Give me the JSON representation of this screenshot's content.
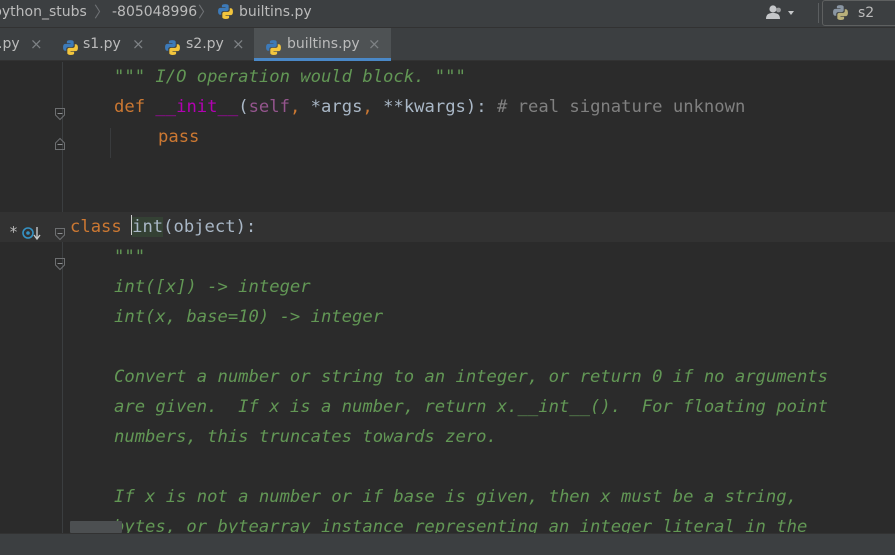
{
  "breadcrumb": {
    "items": [
      "python_stubs",
      "-805048996",
      "builtins.py"
    ]
  },
  "run_config": {
    "label": "s2"
  },
  "tabs": [
    {
      "label": ".py",
      "active": false
    },
    {
      "label": "s1.py",
      "active": false
    },
    {
      "label": "s2.py",
      "active": false
    },
    {
      "label": "builtins.py",
      "active": true
    }
  ],
  "icons": {
    "close": "×",
    "chevron": "〉",
    "star_marker": "*"
  },
  "colors": {
    "keyword": "#cc7832",
    "docstring": "#629755",
    "comment": "#808080",
    "accent": "#4a88c7"
  },
  "code_lines": [
    [
      {
        "c": "doc",
        "t": "\"\"\" I/O operation would block. \"\"\""
      }
    ],
    [
      {
        "c": "kw",
        "t": "def "
      },
      {
        "c": "fn",
        "t": "__init__"
      },
      {
        "c": "dflt",
        "t": "("
      },
      {
        "c": "slf",
        "t": "self"
      },
      {
        "c": "kw",
        "t": ", "
      },
      {
        "c": "dflt",
        "t": "*args"
      },
      {
        "c": "kw",
        "t": ", "
      },
      {
        "c": "dflt",
        "t": "**kwargs): "
      },
      {
        "c": "cm",
        "t": "# real signature unknown"
      }
    ],
    [
      {
        "c": "kw",
        "t": "pass"
      }
    ],
    [],
    [],
    [
      {
        "c": "kw",
        "t": "class "
      },
      {
        "c": "caret",
        "t": ""
      },
      {
        "c": "hl",
        "t": "int"
      },
      {
        "c": "dflt",
        "t": "(object):"
      }
    ],
    [
      {
        "c": "doc",
        "t": "\"\"\""
      }
    ],
    [
      {
        "c": "doc",
        "t": "int([x]) -> integer"
      }
    ],
    [
      {
        "c": "doc",
        "t": "int(x, base=10) -> integer"
      }
    ],
    [],
    [
      {
        "c": "doc",
        "t": "Convert a number or string to an integer, or return 0 if no arguments"
      }
    ],
    [
      {
        "c": "doc",
        "t": "are given.  If x is a number, return x.__int__().  For floating point"
      }
    ],
    [
      {
        "c": "doc",
        "t": "numbers, this truncates towards zero."
      }
    ],
    [],
    [
      {
        "c": "doc",
        "t": "If x is not a number or if base is given, then x must be a string,"
      }
    ],
    [
      {
        "c": "doc",
        "t": "bytes, or bytearray instance representing an integer literal in the"
      }
    ]
  ]
}
